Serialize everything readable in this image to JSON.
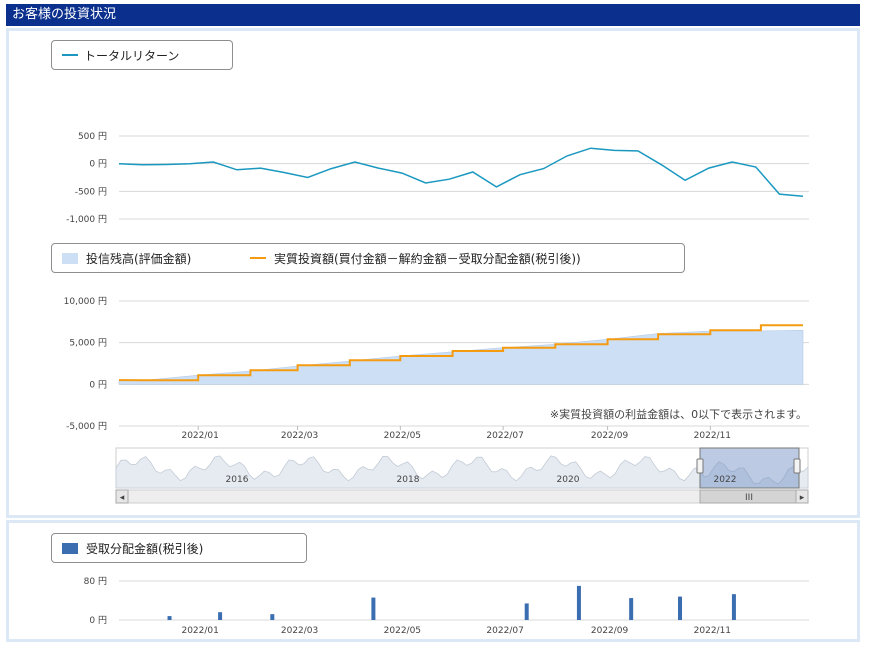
{
  "header": {
    "title": "お客様の投資状況"
  },
  "colors": {
    "header_bg": "#0a2f8c",
    "return_line": "#1a98c0",
    "balance_fill": "#cddff5",
    "invested_line": "#f59b10",
    "distribution_bar": "#3b6eb0",
    "nav_fill": "#6b8cc0"
  },
  "total_return": {
    "legend": "トータルリターン",
    "y_ticks": [
      "500 円",
      "0 円",
      "-500 円",
      "-1,000 円"
    ],
    "chart_data": {
      "type": "line",
      "ylim": [
        -1000,
        500
      ],
      "x": [
        "2021-11-15",
        "2021-11-29",
        "2021-12-13",
        "2021-12-27",
        "2022-01-10",
        "2022-01-24",
        "2022-02-07",
        "2022-02-21",
        "2022-03-07",
        "2022-03-21",
        "2022-04-04",
        "2022-04-18",
        "2022-05-02",
        "2022-05-16",
        "2022-05-30",
        "2022-06-13",
        "2022-06-27",
        "2022-07-11",
        "2022-07-25",
        "2022-08-08",
        "2022-08-22",
        "2022-09-05",
        "2022-09-19",
        "2022-10-03",
        "2022-10-17",
        "2022-10-31",
        "2022-11-14",
        "2022-11-28",
        "2022-12-12",
        "2022-12-26"
      ],
      "series": [
        {
          "values": [
            0,
            -20,
            -15,
            0,
            30,
            -110,
            -80,
            -160,
            -250,
            -90,
            30,
            -80,
            -170,
            -350,
            -280,
            -150,
            -420,
            -200,
            -90,
            140,
            280,
            240,
            230,
            -20,
            -300,
            -80,
            30,
            -60,
            -550,
            -590
          ]
        }
      ]
    }
  },
  "balance": {
    "legend_balance": "投信残高(評価金額)",
    "legend_invested": "実質投資額(買付金額－解約金額－受取分配金額(税引後))",
    "note": "※実質投資額の利益金額は、0以下で表示されます。",
    "y_ticks": [
      "10,000 円",
      "5,000 円",
      "0 円",
      "-5,000 円"
    ],
    "x_ticks": [
      "2022/01",
      "2022/03",
      "2022/05",
      "2022/07",
      "2022/09",
      "2022/11"
    ],
    "chart_data": {
      "type": "area",
      "ylim": [
        -5000,
        10000
      ],
      "x": [
        "2021-11-15",
        "2021-12-01",
        "2022-01-01",
        "2022-02-01",
        "2022-03-01",
        "2022-04-01",
        "2022-05-01",
        "2022-06-01",
        "2022-07-01",
        "2022-08-01",
        "2022-09-01",
        "2022-10-01",
        "2022-11-01",
        "2022-12-01",
        "2022-12-26"
      ],
      "series": [
        {
          "values": [
            500,
            500,
            1100,
            1600,
            2200,
            2800,
            3400,
            3900,
            4400,
            4800,
            5400,
            6100,
            6400,
            6400,
            6500
          ]
        },
        {
          "values": [
            500,
            500,
            1100,
            1700,
            2300,
            2900,
            3400,
            4000,
            4400,
            4800,
            5400,
            6000,
            6500,
            7100,
            7100
          ]
        }
      ]
    }
  },
  "navigator": {
    "x_ticks": [
      "2016",
      "2018",
      "2020",
      "2022"
    ],
    "scroll_left": "◂",
    "scroll_right": "▸",
    "scroll_grip": "III"
  },
  "distribution": {
    "legend": "受取分配金額(税引後)",
    "y_ticks": [
      "80 円",
      "0 円"
    ],
    "x_ticks": [
      "2022/01",
      "2022/03",
      "2022/05",
      "2022/07",
      "2022/09",
      "2022/11"
    ],
    "chart_data": {
      "type": "bar",
      "ylim": [
        0,
        100
      ],
      "x": [
        "2021-12-15",
        "2022-01-14",
        "2022-02-14",
        "2022-04-15",
        "2022-07-15",
        "2022-08-15",
        "2022-09-15",
        "2022-10-14",
        "2022-11-15"
      ],
      "values": [
        8,
        16,
        12,
        46,
        34,
        70,
        45,
        48,
        53
      ]
    }
  }
}
